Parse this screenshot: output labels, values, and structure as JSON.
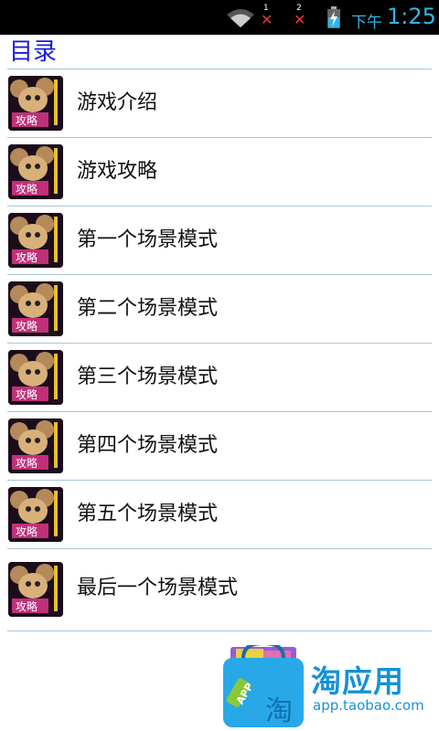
{
  "statusbar": {
    "sim1_number": "1",
    "sim2_number": "2",
    "ampm": "下午",
    "time": "1:25"
  },
  "header": {
    "title": "目录"
  },
  "items": [
    {
      "label": "游戏介绍",
      "thumb_text": "攻略"
    },
    {
      "label": "游戏攻略",
      "thumb_text": "攻略"
    },
    {
      "label": "第一个场景模式",
      "thumb_text": "攻略"
    },
    {
      "label": "第二个场景模式",
      "thumb_text": "攻略"
    },
    {
      "label": "第三个场景模式",
      "thumb_text": "攻略"
    },
    {
      "label": "第四个场景模式",
      "thumb_text": "攻略"
    },
    {
      "label": "第五个场景模式",
      "thumb_text": "攻略"
    },
    {
      "label": "最后一个场景模式",
      "thumb_text": "攻略"
    }
  ],
  "watermark": {
    "name": "淘应用",
    "url": "app.taobao.com",
    "logo_tag": "APP",
    "logo_char": "淘"
  },
  "colors": {
    "statusbar_bg": "#000000",
    "clock": "#33b5e5",
    "header_text": "#1a1adb",
    "divider": "#a9c4dc",
    "watermark": "#1392d8"
  }
}
